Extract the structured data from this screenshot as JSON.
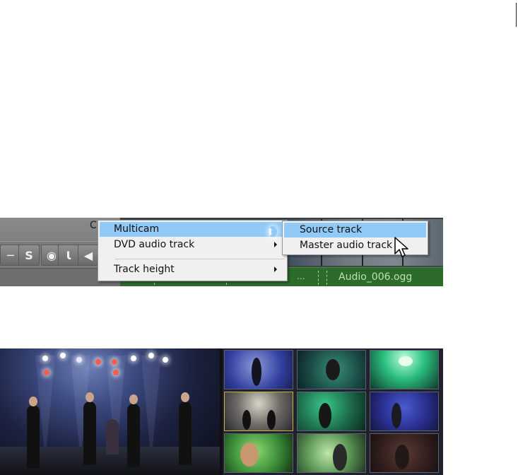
{
  "track_header": {
    "partial_letter": "C",
    "controls": [
      {
        "name": "minimize-track-button",
        "glyph": "─"
      },
      {
        "name": "solo-button",
        "glyph": "S"
      },
      {
        "name": "visibility-eye-button",
        "glyph": "◉"
      },
      {
        "name": "split-button",
        "glyph": "Ɩ"
      },
      {
        "name": "mute-speaker-button",
        "glyph": "◀"
      }
    ]
  },
  "timeline": {
    "audio_clip_label": "Audio_006.ogg",
    "truncated_clip": "..."
  },
  "context_menu": {
    "items": [
      {
        "label": "Multicam",
        "has_submenu": true,
        "highlighted": true
      },
      {
        "label": "DVD audio track",
        "has_submenu": true,
        "highlighted": false
      },
      {
        "label": "Track height",
        "has_submenu": true,
        "highlighted": false
      }
    ]
  },
  "submenu": {
    "items": [
      {
        "label": "Source track",
        "highlighted": true
      },
      {
        "label": "Master audio track",
        "highlighted": false
      }
    ]
  },
  "colors": {
    "menu_background": "#f0f0f0",
    "menu_highlight": "#91c9f7",
    "audio_clip": "#2d6b2b",
    "audio_text": "#b9e4a4",
    "selected_cell_border": "#c8b43a"
  },
  "multicam_preview": {
    "camera_count": 9,
    "selected_camera": 4
  }
}
